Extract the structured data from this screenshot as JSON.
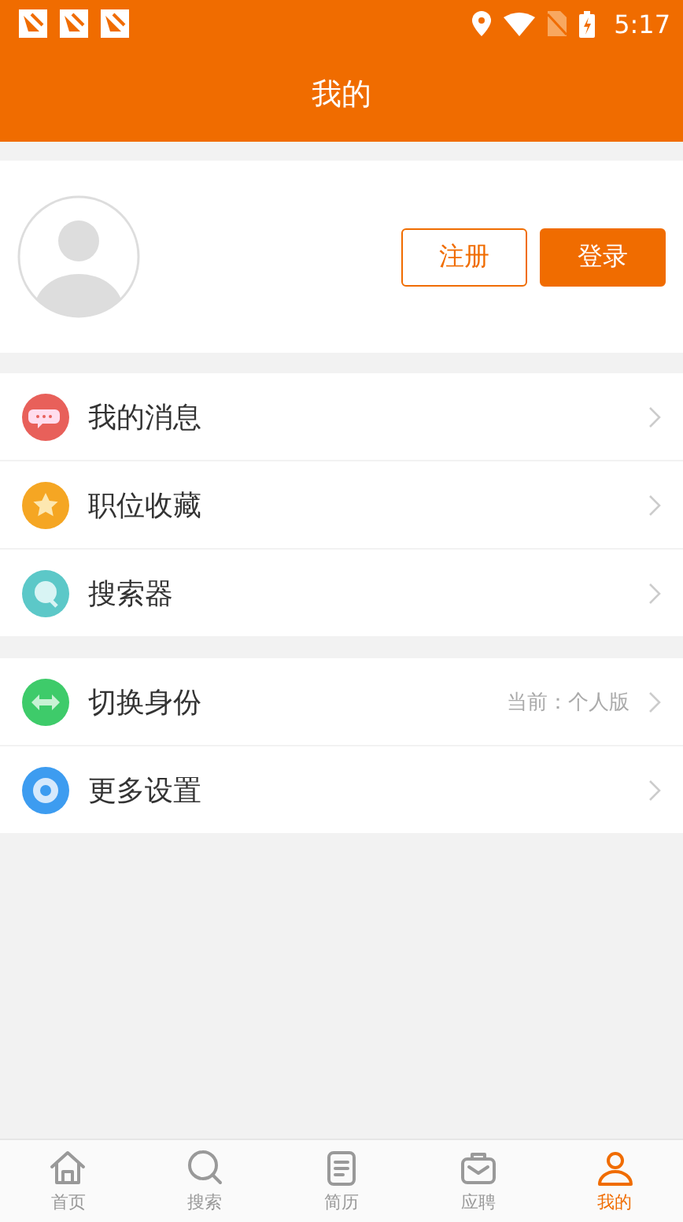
{
  "status_bar": {
    "time": "5:17"
  },
  "header": {
    "title": "我的"
  },
  "profile": {
    "register_button": "注册",
    "login_button": "登录"
  },
  "menu_groups": [
    {
      "items": [
        {
          "kind": "message",
          "label": "我的消息",
          "color": "#e8605a"
        },
        {
          "kind": "star",
          "label": "职位收藏",
          "color": "#f5a623"
        },
        {
          "kind": "search",
          "label": "搜索器",
          "color": "#5cc8c8"
        }
      ]
    },
    {
      "items": [
        {
          "kind": "switch",
          "label": "切换身份",
          "color": "#3ecb6a",
          "detail": "当前：个人版"
        },
        {
          "kind": "settings",
          "label": "更多设置",
          "color": "#3d9cf0"
        }
      ]
    }
  ],
  "tab_bar": [
    {
      "kind": "home",
      "label": "首页",
      "selected": false
    },
    {
      "kind": "search",
      "label": "搜索",
      "selected": false
    },
    {
      "kind": "resume",
      "label": "简历",
      "selected": false
    },
    {
      "kind": "jobs",
      "label": "应聘",
      "selected": false
    },
    {
      "kind": "me",
      "label": "我的",
      "selected": true
    }
  ]
}
